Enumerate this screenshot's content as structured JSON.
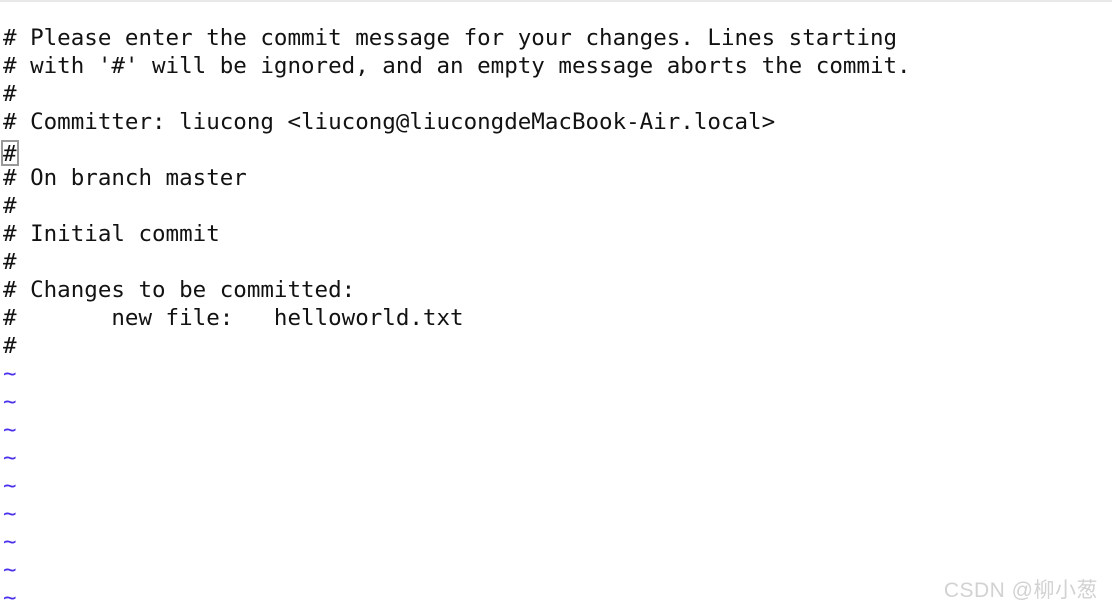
{
  "app": {
    "name": "vim",
    "context": "git-commit-message-editor",
    "background_color": "#ffffff",
    "text_color": "#121212",
    "tilde_color": "#4831e8",
    "cursor_color": "#999999",
    "watermark_color": "#d2d2d2"
  },
  "buffer": {
    "lines": [
      "# Please enter the commit message for your changes. Lines starting",
      "# with '#' will be ignored, and an empty message aborts the commit.",
      "#",
      "# Committer: liucong <liucong@liucongdeMacBook-Air.local>",
      "#",
      "# On branch master",
      "#",
      "# Initial commit",
      "#",
      "# Changes to be committed:",
      "#\tnew file:   helloworld.txt",
      "#"
    ],
    "rendered_lines": [
      "# Please enter the commit message for your changes. Lines starting",
      "# with '#' will be ignored, and an empty message aborts the commit.",
      "#",
      "# Committer: liucong <liucong@liucongdeMacBook-Air.local>",
      "# On branch master",
      "#",
      "# Initial commit",
      "#",
      "# Changes to be committed:",
      "#       new file:   helloworld.txt",
      "#"
    ],
    "cursor": {
      "line_index": 4,
      "column": 0,
      "character": "#",
      "style": "hollow-block"
    },
    "empty_line_marker": "~",
    "empty_line_count": 9
  },
  "watermark": {
    "text": "CSDN @柳小葱"
  }
}
